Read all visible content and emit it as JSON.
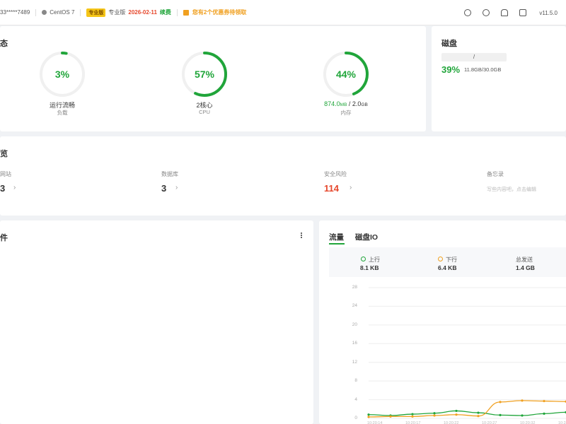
{
  "topbar": {
    "host": "33*****7489",
    "os": "CentOS 7",
    "pro_badge": "专业版",
    "edition": "专业版",
    "expire_date": "2026-02-11",
    "renew": "续费",
    "gift": "您有2个优惠券待领取",
    "version": "v11.5.0"
  },
  "status": {
    "title": "态",
    "gauges": [
      {
        "value_text": "3%",
        "label": "运行流畅",
        "sub": "负载",
        "percent": 3
      },
      {
        "value_text": "57%",
        "label": "2核心",
        "sub": "CPU",
        "percent": 57
      },
      {
        "value_text": "44%",
        "label_used": "874.0",
        "label_used_unit": "MB",
        "label_total": " / 2.0",
        "label_total_unit": "GB",
        "sub": "内存",
        "percent": 44
      }
    ]
  },
  "disk": {
    "title": "磁盘",
    "mount": "/",
    "percent_text": "39%",
    "size": "11.8GB/30.0GB"
  },
  "overview": {
    "title": "览",
    "items": [
      {
        "label": "网站",
        "value": "3",
        "arrow": "›"
      },
      {
        "label": "数据库",
        "value": "3",
        "arrow": "›"
      },
      {
        "label": "安全风险",
        "value": "114",
        "arrow": "›"
      },
      {
        "label": "备忘录",
        "note": "写些内容吧，点击编辑"
      }
    ]
  },
  "software": {
    "title": "件"
  },
  "traffic": {
    "tabs": [
      "流量",
      "磁盘IO"
    ],
    "stats": [
      {
        "label": "上行",
        "value": "8.1 KB"
      },
      {
        "label": "下行",
        "value": "6.4 KB"
      },
      {
        "label": "总发送",
        "value": "1.4 GB"
      }
    ],
    "colors": {
      "up": "#20a53a",
      "down": "#f0a020"
    }
  },
  "chart_data": {
    "type": "line",
    "yticks": [
      "28",
      "24",
      "20",
      "16",
      "12",
      "8",
      "4",
      "0"
    ],
    "ylim": [
      0,
      28
    ],
    "xticks": [
      "10:20:14",
      "10:20:17",
      "10:20:22",
      "10:20:27",
      "10:20:32",
      "10:20:37"
    ],
    "series": [
      {
        "name": "上行",
        "color": "#20a53a",
        "values": [
          0.8,
          0.6,
          0.9,
          1.1,
          1.6,
          1.2,
          0.7,
          0.6,
          1.0,
          1.3
        ]
      },
      {
        "name": "下行",
        "color": "#f0a020",
        "values": [
          0.3,
          0.4,
          0.4,
          0.6,
          0.8,
          0.5,
          3.5,
          3.8,
          3.7,
          3.6
        ]
      }
    ]
  }
}
